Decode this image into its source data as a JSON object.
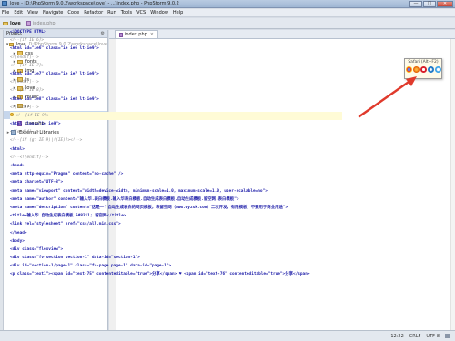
{
  "window": {
    "title": "love - [D:\\PhpStorm 9.0.2\\workspace\\love] - ...\\index.php - PhpStorm 9.0.2",
    "controls": [
      "—",
      "□",
      "✕"
    ]
  },
  "menu": [
    "File",
    "Edit",
    "View",
    "Navigate",
    "Code",
    "Refactor",
    "Run",
    "Tools",
    "VCS",
    "Window",
    "Help"
  ],
  "nav": {
    "project": "love",
    "file": "index.php"
  },
  "project_panel": {
    "header": "Project",
    "items": [
      {
        "label": "love",
        "extra": "D:\\PhpStorm 9.0.2\\workspace\\love",
        "type": "root",
        "expanded": true
      },
      {
        "label": "css",
        "type": "folder"
      },
      {
        "label": "fonts",
        "type": "folder"
      },
      {
        "label": "img",
        "type": "folder"
      },
      {
        "label": "js",
        "type": "folder"
      },
      {
        "label": "love",
        "type": "folder"
      },
      {
        "label": "music",
        "type": "folder"
      },
      {
        "label": "rz",
        "type": "folder"
      },
      {
        "label": "index.php",
        "type": "php",
        "selected": true
      },
      {
        "label": "love.php",
        "type": "php"
      },
      {
        "label": "External Libraries",
        "type": "lib"
      }
    ]
  },
  "editor": {
    "tab": "index.php",
    "lines": [
      {
        "text": "<!DOCTYPE HTML>",
        "kind": "tag"
      },
      {
        "text": "<!--[if IE 6]>",
        "kind": "cm"
      },
      {
        "text": "<html id=\"ie6\" class=\"ie ie6 lt-ie9\">",
        "kind": "tag"
      },
      {
        "text": "<![endif]-->",
        "kind": "cm"
      },
      {
        "text": "<!--[if IE 7]>",
        "kind": "cm"
      },
      {
        "text": "<html id=\"ie7\" class=\"ie ie7 lt-ie9\">",
        "kind": "tag"
      },
      {
        "text": "<![endif]-->",
        "kind": "cm"
      },
      {
        "text": "<!--[if IE 8]>",
        "kind": "cm"
      },
      {
        "text": "<html id=\"ie8\" class=\"ie ie8 lt-ie9\">",
        "kind": "tag"
      },
      {
        "text": "<![endif]-->",
        "kind": "cm"
      },
      {
        "text": "<!--[if IE 9]>",
        "kind": "cm",
        "highlight": true,
        "bulb": true
      },
      {
        "text": "<html class=\"ie ie9\">",
        "kind": "tag"
      },
      {
        "text": "<![endif]-->",
        "kind": "cm"
      },
      {
        "text": "<!--[if (gt IE 9)|!(IE)]><!-->",
        "kind": "cm"
      },
      {
        "text": "<html>",
        "kind": "tag"
      },
      {
        "text": "<!--<![endif]-->",
        "kind": "cm"
      },
      {
        "text": "<head>",
        "kind": "tag"
      },
      {
        "text": "    <meta http-equiv=\"Pragma\" content=\"no-cache\" />",
        "kind": "tag"
      },
      {
        "text": "    <meta charset=\"UTF-8\">",
        "kind": "tag"
      },
      {
        "text": "    <meta name=\"viewport\" content=\"width=device-width, minimum-scale=1.0, maximum-scale=1.0, user-scalable=no\">",
        "kind": "tag"
      },
      {
        "text": "    <meta name=\"author\" content=\"输入华.表白模板.输入华表白模板.自动生成表白模板.自动生成模板.留空网.表白模板\">",
        "kind": "tag"
      },
      {
        "text": "    <meta name=\"description\" content=\"这是一个自动生成表白的网页模板，表留空网（www.wyzsk.com）二次开发，有限模板，不要用于商业用途\">",
        "kind": "tag"
      },
      {
        "text": "    <title>输入华.自动生成表白模板 &#8211; 留空网</title>",
        "kind": "tag"
      },
      {
        "text": "    <link rel=\"stylesheet\" href=\"css/all.min.css\">",
        "kind": "tag"
      },
      {
        "text": "</head>",
        "kind": "tag"
      },
      {
        "text": "<body>",
        "kind": "tag"
      },
      {
        "text": "    <div class=\"flexview\">",
        "kind": "tag"
      },
      {
        "text": "        <div class=\"fv-section section-1\" data-id=\"section-1\">",
        "kind": "tag"
      },
      {
        "text": "            <div id=\"section-1/page-1\" class=\"fv-page page-1\" data-id=\"page-1\">",
        "kind": "tag"
      },
      {
        "text": "                <p class=\"text1\"><span id=\"text-75\" contenteditable=\"true\">分享</span> ♥ <span id=\"text-76\" contenteditable=\"true\">分享</span>",
        "kind": "tag"
      }
    ]
  },
  "browser_popup": {
    "tip": "Safari (Alt+F2)",
    "browsers": [
      "chrome",
      "firefox",
      "opera",
      "ie",
      "safari"
    ]
  },
  "status": {
    "position": "12:22",
    "line_sep": "CRLF",
    "encoding": "UTF-8"
  },
  "colors": {
    "arrow": "#e03a2c",
    "tag": "#1c1ca8",
    "comment": "#8a8a8a"
  }
}
